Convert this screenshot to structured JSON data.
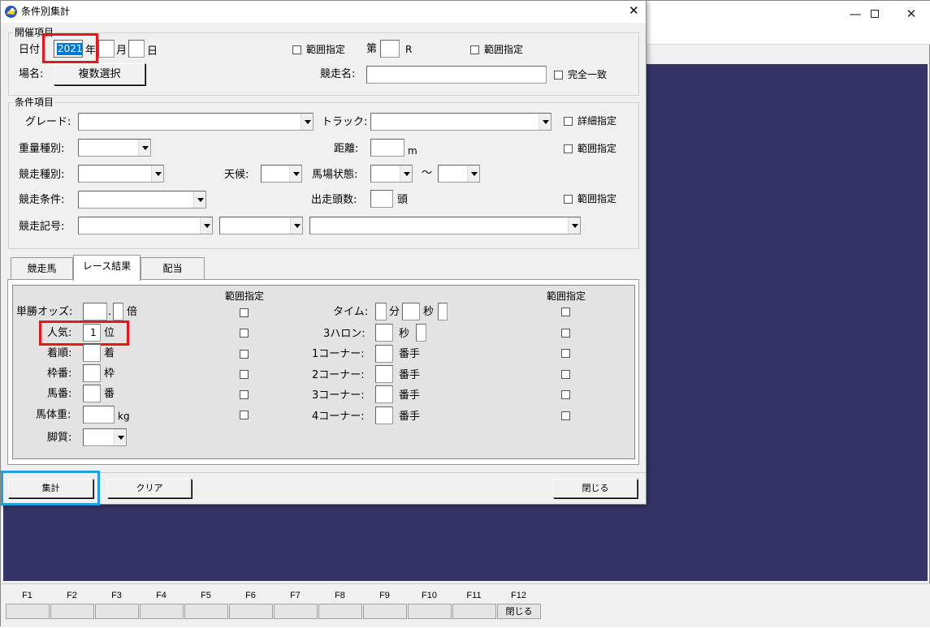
{
  "main_window": {
    "title": "",
    "fkeys": [
      {
        "key": "F1",
        "label": ""
      },
      {
        "key": "F2",
        "label": ""
      },
      {
        "key": "F3",
        "label": ""
      },
      {
        "key": "F4",
        "label": ""
      },
      {
        "key": "F5",
        "label": ""
      },
      {
        "key": "F6",
        "label": ""
      },
      {
        "key": "F7",
        "label": ""
      },
      {
        "key": "F8",
        "label": ""
      },
      {
        "key": "F9",
        "label": ""
      },
      {
        "key": "F10",
        "label": ""
      },
      {
        "key": "F11",
        "label": ""
      },
      {
        "key": "F12",
        "label": "閉じる"
      }
    ]
  },
  "dialog": {
    "title": "条件別集計",
    "close_glyph": "✕",
    "kaisai": {
      "group_title": "開催項目",
      "date_label": "日付",
      "year_value": "2021",
      "year_unit": "年",
      "month_value": "",
      "month_unit": "月",
      "day_value": "",
      "day_unit": "日",
      "range1_label": "範囲指定",
      "dai_label": "第",
      "race_no_value": "",
      "r_label": "R",
      "range2_label": "範囲指定",
      "venue_label": "場名:",
      "multi_select_label": "複数選択",
      "race_name_label": "競走名:",
      "race_name_value": "",
      "exact_match_label": "完全一致"
    },
    "joken": {
      "group_title": "条件項目",
      "grade_label": "グレード:",
      "track_label": "トラック:",
      "detail_label": "詳細指定",
      "weight_type_label": "重量種別:",
      "distance_label": "距離:",
      "distance_unit": "m",
      "distance_range_label": "範囲指定",
      "race_type_label": "競走種別:",
      "weather_label": "天候:",
      "going_label": "馬場状態:",
      "tilde": "〜",
      "race_cond_label": "競走条件:",
      "runners_label": "出走頭数:",
      "runners_unit": "頭",
      "runners_range_label": "範囲指定",
      "race_symbol_label": "競走記号:"
    },
    "tabs": [
      "競走馬",
      "レース結果",
      "配当"
    ],
    "result": {
      "range_header_left": "範囲指定",
      "range_header_right": "範囲指定",
      "win_odds_label": "単勝オッズ:",
      "dot": ".",
      "odds_unit": "倍",
      "popularity_label": "人気:",
      "popularity_value": "1",
      "popularity_unit": "位",
      "finish_label": "着順:",
      "finish_unit": "着",
      "bracket_label": "枠番:",
      "bracket_unit": "枠",
      "horse_no_label": "馬番:",
      "horse_no_unit": "番",
      "weight_label": "馬体重:",
      "weight_unit": "kg",
      "style_label": "脚質:",
      "time_label": "タイム:",
      "min_unit": "分",
      "sec_unit": "秒",
      "three_f_label": "3ハロン:",
      "three_f_unit": "秒",
      "corner1_label": "1コーナー:",
      "corner2_label": "2コーナー:",
      "corner3_label": "3コーナー:",
      "corner4_label": "4コーナー:",
      "corner_unit": "番手"
    },
    "buttons": {
      "aggregate": "集計",
      "clear": "クリア",
      "close": "閉じる"
    }
  }
}
